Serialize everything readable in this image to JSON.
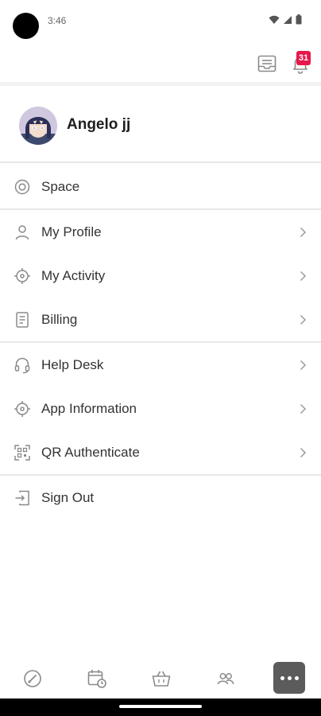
{
  "status_bar": {
    "time": "3:46",
    "icons": [
      "wifi-icon",
      "signal-icon",
      "battery-icon"
    ]
  },
  "top_bar": {
    "inbox_icon": "inbox-icon",
    "notification_icon": "bell-icon",
    "notification_count": "31"
  },
  "profile": {
    "name": "Angelo jj"
  },
  "menu": {
    "space": {
      "label": "Space",
      "icon": "target-icon"
    },
    "my_profile": {
      "label": "My Profile",
      "icon": "person-icon"
    },
    "my_activity": {
      "label": "My Activity",
      "icon": "crosshair-icon"
    },
    "billing": {
      "label": "Billing",
      "icon": "document-icon"
    },
    "help_desk": {
      "label": "Help Desk",
      "icon": "headset-icon"
    },
    "app_information": {
      "label": "App Information",
      "icon": "crosshair-icon"
    },
    "qr_authenticate": {
      "label": "QR Authenticate",
      "icon": "qr-code-icon"
    },
    "sign_out": {
      "label": "Sign Out",
      "icon": "sign-out-icon"
    }
  },
  "bottom_nav": {
    "items": [
      "dashboard-gauge-icon",
      "calendar-clock-icon",
      "basket-icon",
      "people-icon",
      "more-icon"
    ],
    "active": "more-icon"
  },
  "colors": {
    "badge": "#e8174a",
    "icon_stroke": "#8a8a8a",
    "more_button_bg": "#5b5b5b",
    "divider": "#e8e8e8"
  }
}
